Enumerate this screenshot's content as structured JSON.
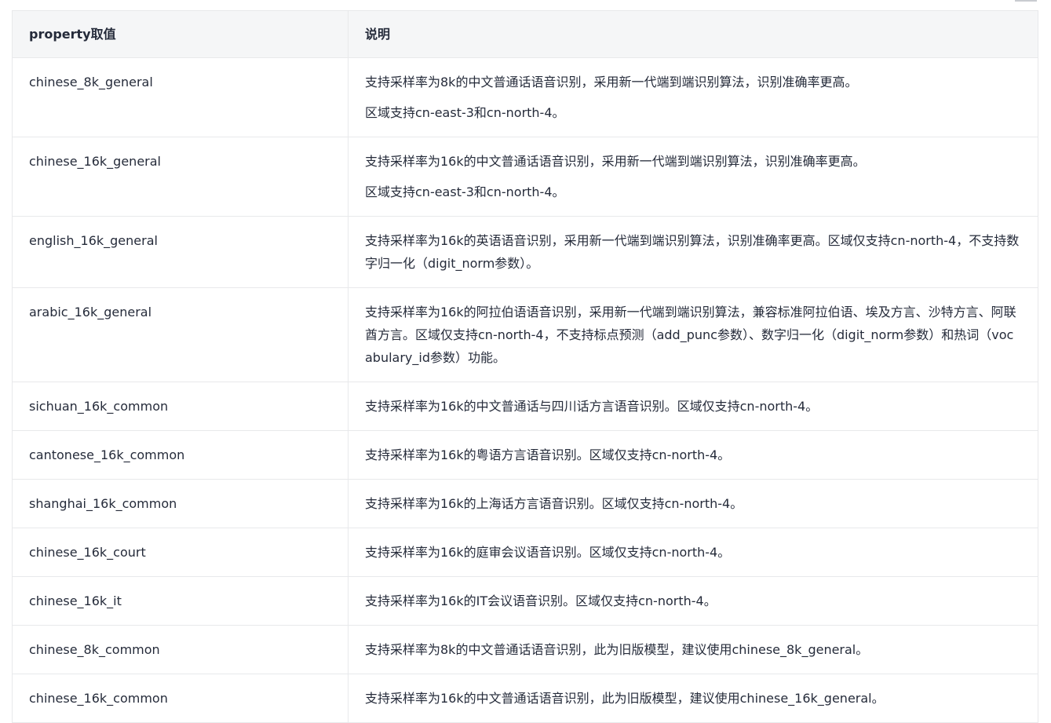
{
  "table": {
    "headers": {
      "property": "property取值",
      "description": "说明"
    },
    "rows": [
      {
        "property": "chinese_8k_general",
        "description": "支持采样率为8k的中文普通话语音识别，采用新一代端到端识别算法，识别准确率更高。",
        "note": "区域支持cn-east-3和cn-north-4。"
      },
      {
        "property": "chinese_16k_general",
        "description": "支持采样率为16k的中文普通话语音识别，采用新一代端到端识别算法，识别准确率更高。",
        "note": "区域支持cn-east-3和cn-north-4。"
      },
      {
        "property": "english_16k_general",
        "description": "支持采样率为16k的英语语音识别，采用新一代端到端识别算法，识别准确率更高。区域仅支持cn-north-4，不支持数字归一化（digit_norm参数）。"
      },
      {
        "property": "arabic_16k_general",
        "description": "支持采样率为16k的阿拉伯语语音识别，采用新一代端到端识别算法，兼容标准阿拉伯语、埃及方言、沙特方言、阿联酋方言。区域仅支持cn-north-4，不支持标点预测（add_punc参数）、数字归一化（digit_norm参数）和热词（vocabulary_id参数）功能。"
      },
      {
        "property": "sichuan_16k_common",
        "description": "支持采样率为16k的中文普通话与四川话方言语音识别。区域仅支持cn-north-4。"
      },
      {
        "property": "cantonese_16k_common",
        "description": "支持采样率为16k的粤语方言语音识别。区域仅支持cn-north-4。"
      },
      {
        "property": "shanghai_16k_common",
        "description": "支持采样率为16k的上海话方言语音识别。区域仅支持cn-north-4。"
      },
      {
        "property": "chinese_16k_court",
        "description": "支持采样率为16k的庭审会议语音识别。区域仅支持cn-north-4。"
      },
      {
        "property": "chinese_16k_it",
        "description": "支持采样率为16k的IT会议语音识别。区域仅支持cn-north-4。"
      },
      {
        "property": "chinese_8k_common",
        "description": "支持采样率为8k的中文普通话语音识别，此为旧版模型，建议使用chinese_8k_general。"
      },
      {
        "property": "chinese_16k_common",
        "description": "支持采样率为16k的中文普通话语音识别，此为旧版模型，建议使用chinese_16k_general。"
      }
    ]
  }
}
